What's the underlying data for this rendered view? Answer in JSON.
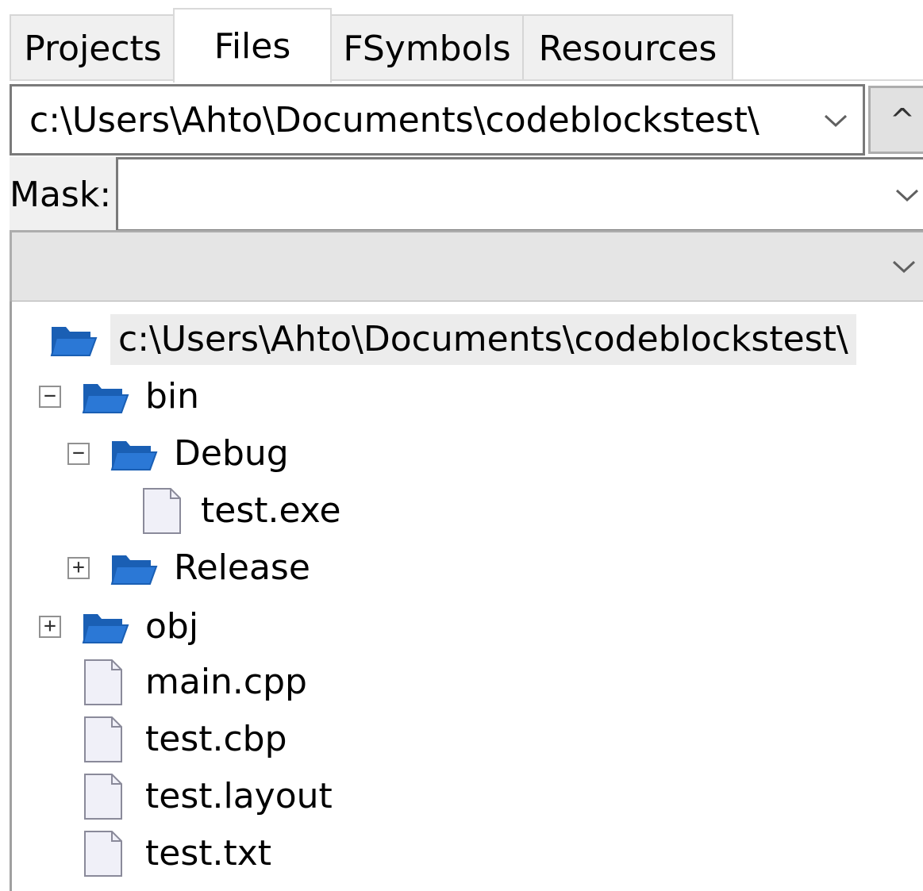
{
  "tabs": [
    {
      "label": "Projects",
      "active": false
    },
    {
      "label": "Files",
      "active": true
    },
    {
      "label": "FSymbols",
      "active": false
    },
    {
      "label": "Resources",
      "active": false
    }
  ],
  "path_combo": {
    "value": "c:\\Users\\Ahto\\Documents\\codeblockstest\\",
    "dropdown_icon": "chevron-down-icon"
  },
  "up_button": {
    "label": "^",
    "icon": "up-icon"
  },
  "mask": {
    "label": "Mask:",
    "value": ""
  },
  "filter": {
    "value": ""
  },
  "tree": {
    "root": "c:\\Users\\Ahto\\Documents\\codeblockstest\\",
    "nodes": [
      {
        "label": "bin",
        "type": "folder",
        "toggle": "⊟",
        "expanded": true
      },
      {
        "label": "Debug",
        "type": "folder",
        "toggle": "⊟",
        "expanded": true
      },
      {
        "label": "test.exe",
        "type": "file"
      },
      {
        "label": "Release",
        "type": "folder",
        "toggle": "⊞",
        "expanded": false
      },
      {
        "label": "obj",
        "type": "folder",
        "toggle": "⊞",
        "expanded": false
      },
      {
        "label": "main.cpp",
        "type": "file"
      },
      {
        "label": "test.cbp",
        "type": "file"
      },
      {
        "label": "test.layout",
        "type": "file"
      },
      {
        "label": "test.txt",
        "type": "file"
      }
    ]
  },
  "colors": {
    "folder_blue": "#2b78d6",
    "folder_dark": "#1a5fb4",
    "file_fill": "#f0f0f8",
    "file_stroke": "#8a8a9a"
  }
}
